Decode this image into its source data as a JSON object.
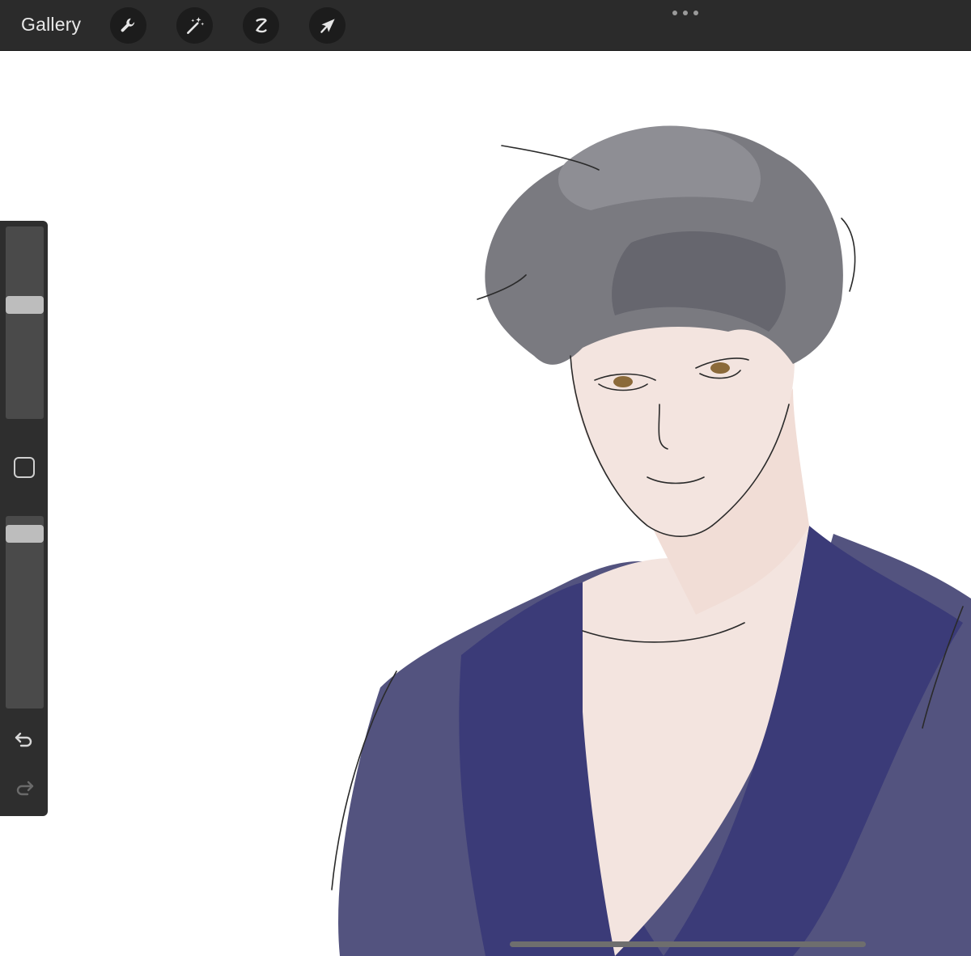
{
  "topbar": {
    "gallery_label": "Gallery",
    "tools": [
      {
        "name": "actions",
        "icon": "wrench-icon"
      },
      {
        "name": "adjustments",
        "icon": "magic-wand-icon"
      },
      {
        "name": "selection",
        "icon": "selection-s-icon"
      },
      {
        "name": "transform",
        "icon": "arrow-cursor-icon"
      }
    ],
    "more_icon": "ellipsis-icon"
  },
  "sidebar": {
    "brush_size_level": 0.6,
    "opacity_level": 0.95,
    "modify_icon": "square-icon",
    "undo_icon": "undo-icon",
    "redo_icon": "redo-icon"
  },
  "canvas": {
    "subject": "illustration",
    "colors": {
      "hair": "#7a7a80",
      "robe": "#3b3b78",
      "robe_light": "#53537f",
      "skin": "#f3e4df",
      "line": "#2a2a2a"
    }
  }
}
